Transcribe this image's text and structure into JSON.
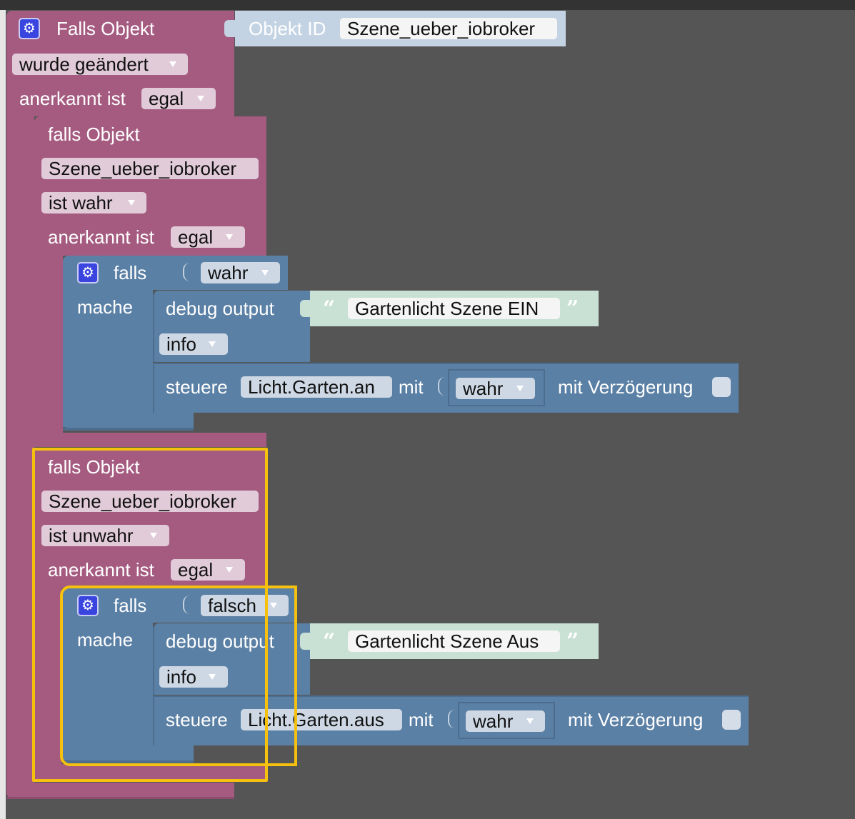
{
  "main_block": {
    "title": "Falls Objekt",
    "object_id_label": "Objekt ID",
    "object_id_value": "Szene_ueber_iobroker",
    "trigger": "wurde geändert",
    "ack_label": "anerkannt ist",
    "ack_value": "egal"
  },
  "if_true_block": {
    "title": "falls Objekt",
    "object": "Szene_ueber_iobroker",
    "condition": "ist wahr",
    "ack_label": "anerkannt ist",
    "ack_value": "egal",
    "falls_label": "falls",
    "falls_value": "wahr",
    "mache_label": "mache",
    "debug_label": "debug output",
    "debug_text": "Gartenlicht Szene EIN",
    "debug_level": "info",
    "control_label": "steuere",
    "control_object": "Licht.Garten.an",
    "with_label": "mit",
    "control_value": "wahr",
    "delay_label": "mit Verzögerung"
  },
  "if_false_block": {
    "title": "falls Objekt",
    "object": "Szene_ueber_iobroker",
    "condition": "ist unwahr",
    "ack_label": "anerkannt ist",
    "ack_value": "egal",
    "falls_label": "falls",
    "falls_value": "falsch",
    "mache_label": "mache",
    "debug_label": "debug output",
    "debug_text": "Gartenlicht Szene Aus",
    "debug_level": "info",
    "control_label": "steuere",
    "control_object": "Licht.Garten.aus",
    "with_label": "mit",
    "control_value": "wahr",
    "delay_label": "mit Verzögerung"
  },
  "icons": {
    "gear": "gear-icon",
    "dropdown": "dropdown-arrow-icon",
    "quote_open": "quote-open-icon",
    "quote_close": "quote-close-icon"
  },
  "colors": {
    "event_block": "#a55b80",
    "logic_block": "#5b80a5",
    "text_block": "#c8e1d4",
    "selection": "#f5c10e",
    "workspace": "#555555"
  }
}
